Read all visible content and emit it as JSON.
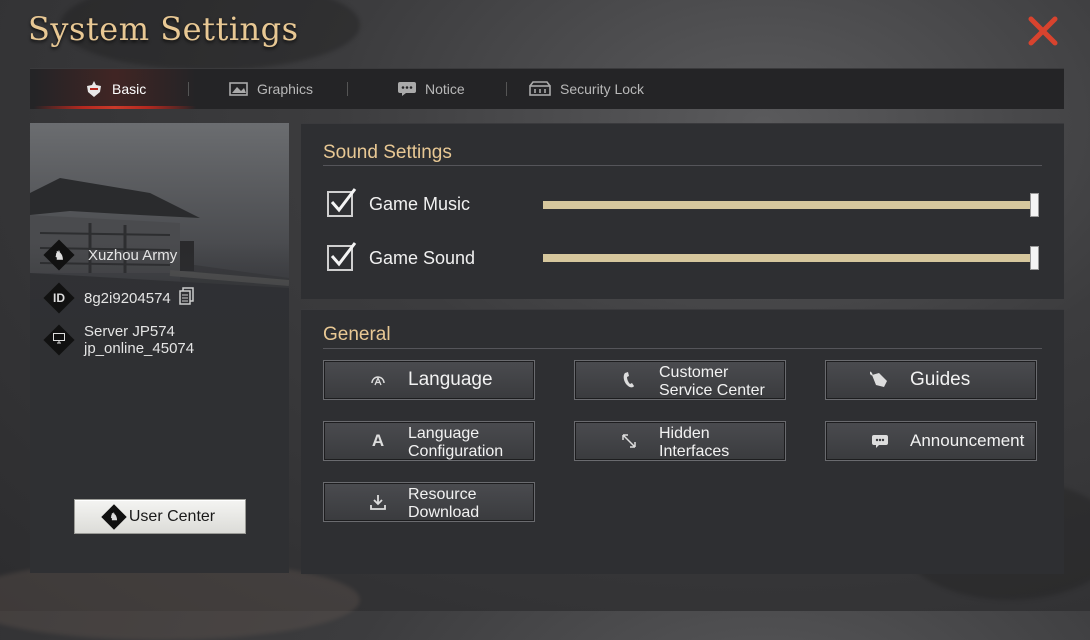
{
  "title": "System Settings",
  "tabs": [
    {
      "label": "Basic",
      "icon": "helmet-icon",
      "active": true
    },
    {
      "label": "Graphics",
      "icon": "image-icon",
      "active": false
    },
    {
      "label": "Notice",
      "icon": "chat-icon",
      "active": false
    },
    {
      "label": "Security Lock",
      "icon": "lock-icon",
      "active": false
    }
  ],
  "profile": {
    "army": "Xuzhou Army",
    "id_badge": "ID",
    "id": "8g2i9204574",
    "server": "Server JP574",
    "server_detail": "jp_online_45074",
    "user_center_label": "User Center"
  },
  "sound": {
    "title": "Sound Settings",
    "rows": [
      {
        "label": "Game Music",
        "checked": true,
        "volume": 1.0
      },
      {
        "label": "Game Sound",
        "checked": true,
        "volume": 1.0
      }
    ]
  },
  "general": {
    "title": "General",
    "buttons": [
      {
        "line1": "Language",
        "line2": "",
        "icon": "language-icon"
      },
      {
        "line1": "Customer",
        "line2": "Service Center",
        "icon": "phone-icon"
      },
      {
        "line1": "Guides",
        "line2": "",
        "icon": "guide-icon"
      },
      {
        "line1": "Language",
        "line2": "Configuration",
        "icon": "font-icon",
        "glyph": "A"
      },
      {
        "line1": "Hidden",
        "line2": "Interfaces",
        "icon": "resize-icon"
      },
      {
        "line1": "Announcement",
        "line2": "",
        "icon": "message-icon"
      },
      {
        "line1": "Resource",
        "line2": "Download",
        "icon": "download-icon"
      }
    ]
  },
  "colors": {
    "accent": "#e8c894",
    "close": "#d8432e",
    "active_tab_underline": "#b3281f",
    "slider": "#cdbd93"
  }
}
